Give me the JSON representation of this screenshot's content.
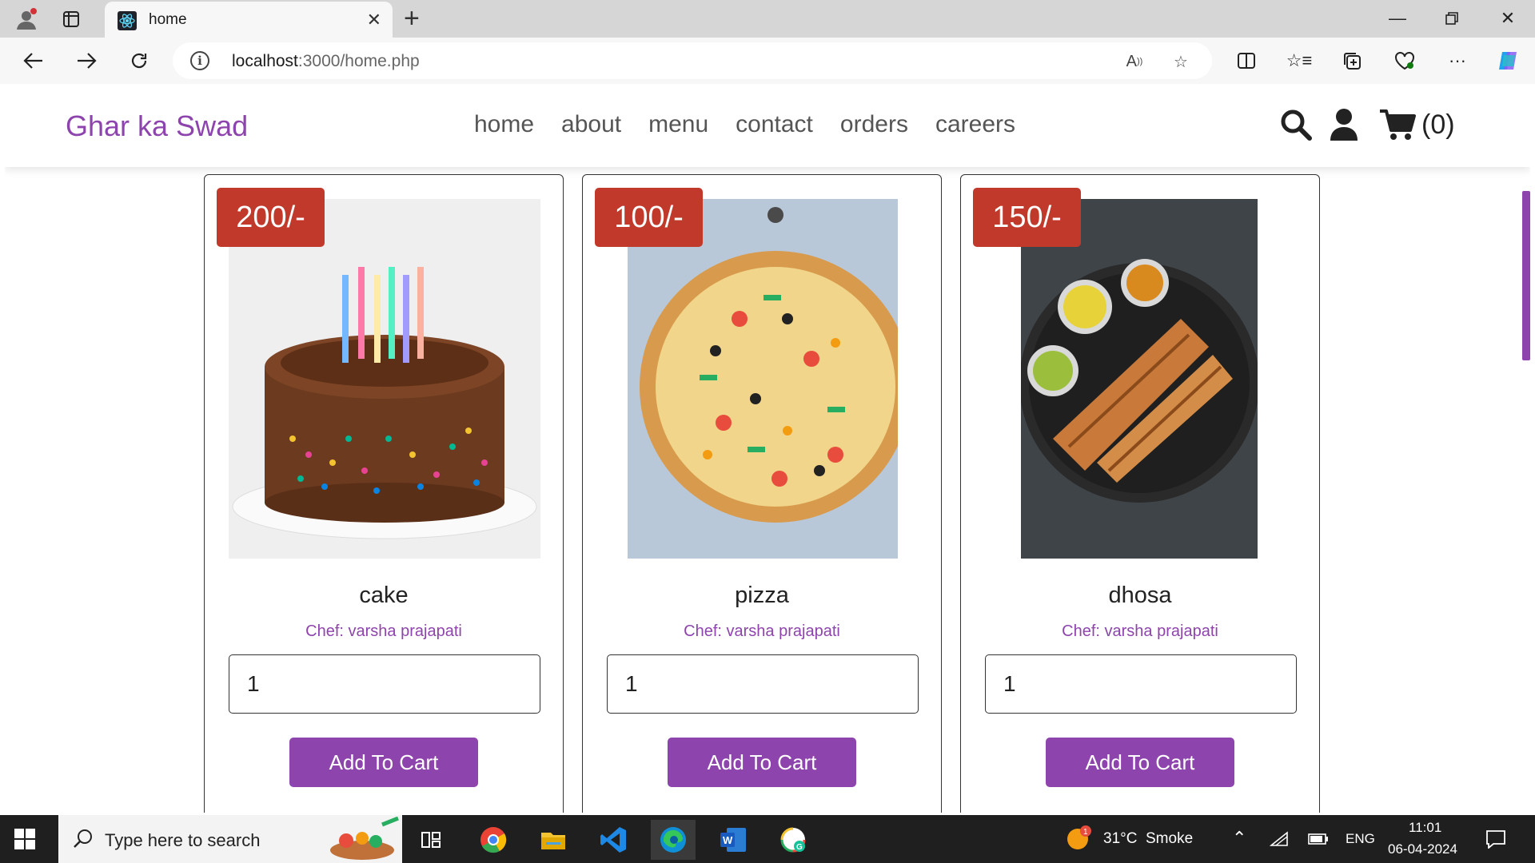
{
  "browser": {
    "tab_title": "home",
    "url_host": "localhost",
    "url_path": ":3000/home.php"
  },
  "site": {
    "logo": "Ghar ka Swad",
    "nav": [
      "home",
      "about",
      "menu",
      "contact",
      "orders",
      "careers"
    ],
    "cart_count": "(0)"
  },
  "products": [
    {
      "price": "200/-",
      "name": "cake",
      "chef": "Chef: varsha prajapati",
      "quantity": "1",
      "button": "Add To Cart"
    },
    {
      "price": "100/-",
      "name": "pizza",
      "chef": "Chef: varsha prajapati",
      "quantity": "1",
      "button": "Add To Cart"
    },
    {
      "price": "150/-",
      "name": "dhosa",
      "chef": "Chef: varsha prajapati",
      "quantity": "1",
      "button": "Add To Cart"
    }
  ],
  "taskbar": {
    "search_placeholder": "Type here to search",
    "weather": "31°C  Smoke",
    "language": "ENG",
    "time": "11:01",
    "date": "06-04-2024",
    "weather_badge": "1"
  },
  "colors": {
    "brand": "#8e44ad",
    "price_badge": "#c0392b"
  }
}
